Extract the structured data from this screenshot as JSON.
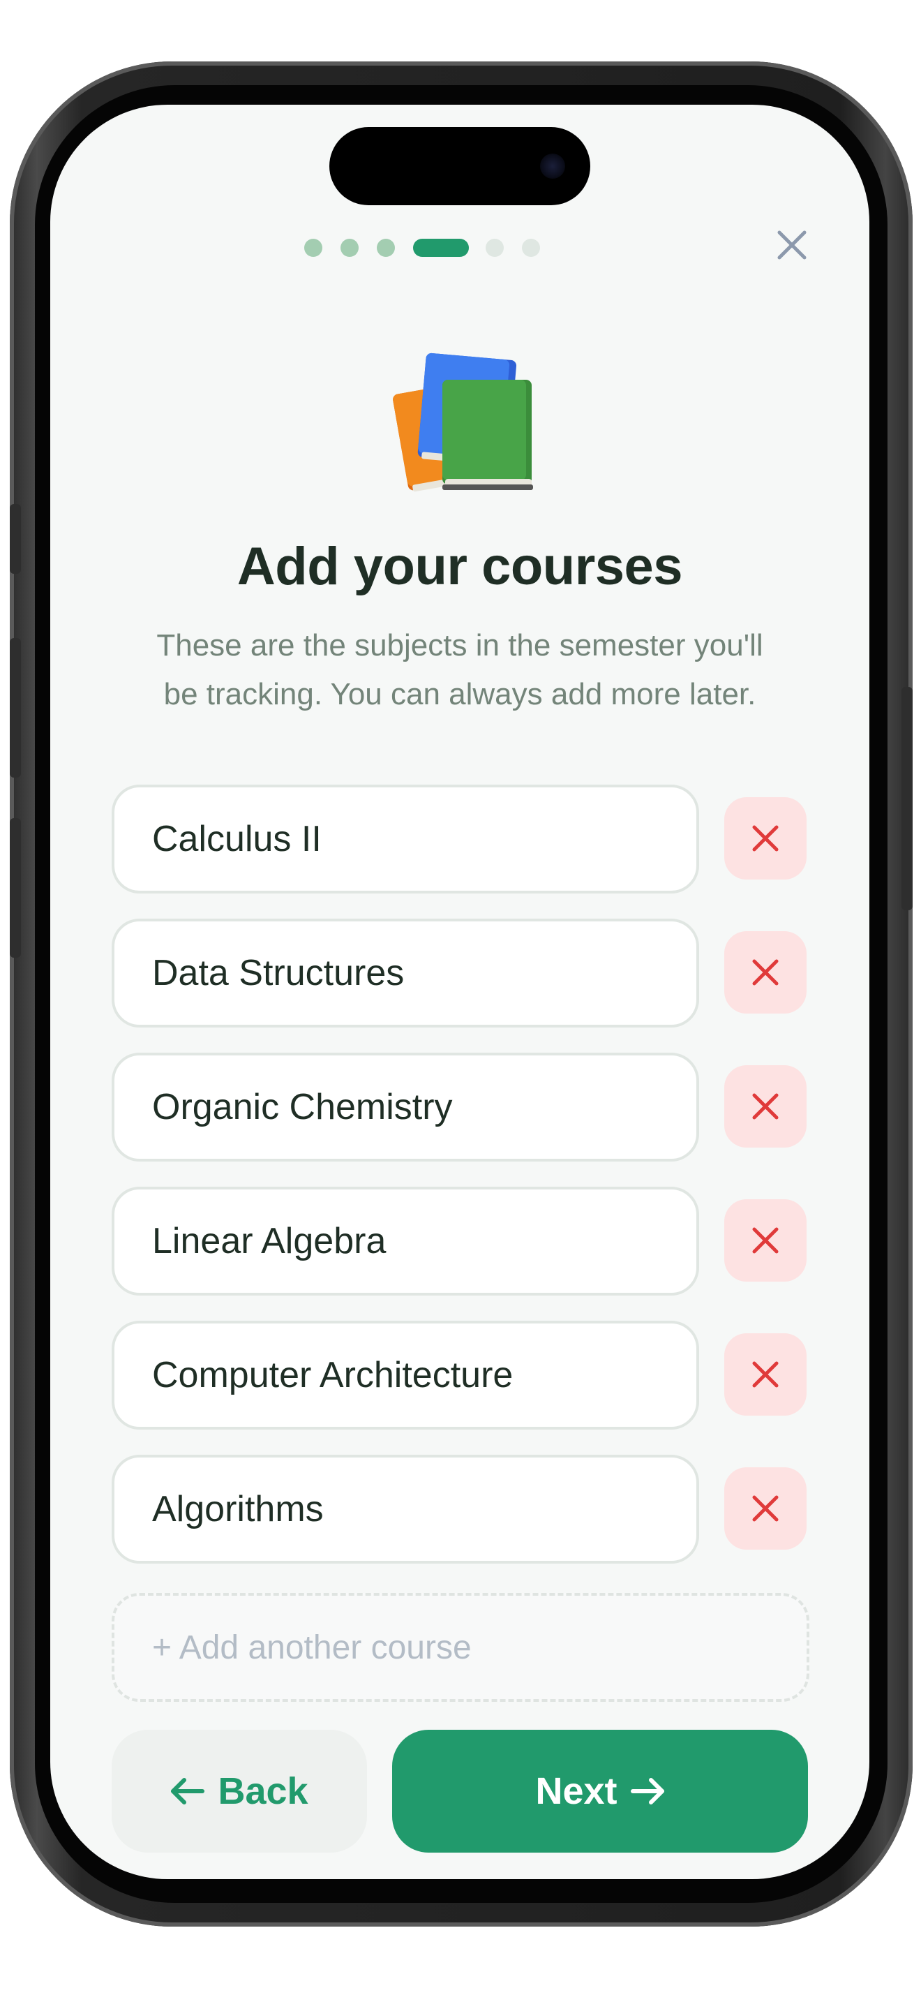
{
  "progress": {
    "total_steps": 6,
    "current_step": 4
  },
  "header": {
    "close_label": "×"
  },
  "hero": {
    "icon": "books-icon"
  },
  "title": "Add your courses",
  "subtitle_line1": "These are the subjects in the semester you'll",
  "subtitle_line2": "be tracking. You can always add more later.",
  "courses": [
    {
      "name": "Calculus II"
    },
    {
      "name": "Data Structures"
    },
    {
      "name": "Organic Chemistry"
    },
    {
      "name": "Linear Algebra"
    },
    {
      "name": "Computer Architecture"
    },
    {
      "name": "Algorithms"
    }
  ],
  "add_course_label": "+ Add another course",
  "footer": {
    "back_label": "Back",
    "next_label": "Next"
  },
  "colors": {
    "accent": "#219a6c",
    "remove_bg": "#fde2e2",
    "remove_icon": "#e03a3a",
    "background": "#f6f8f7"
  }
}
